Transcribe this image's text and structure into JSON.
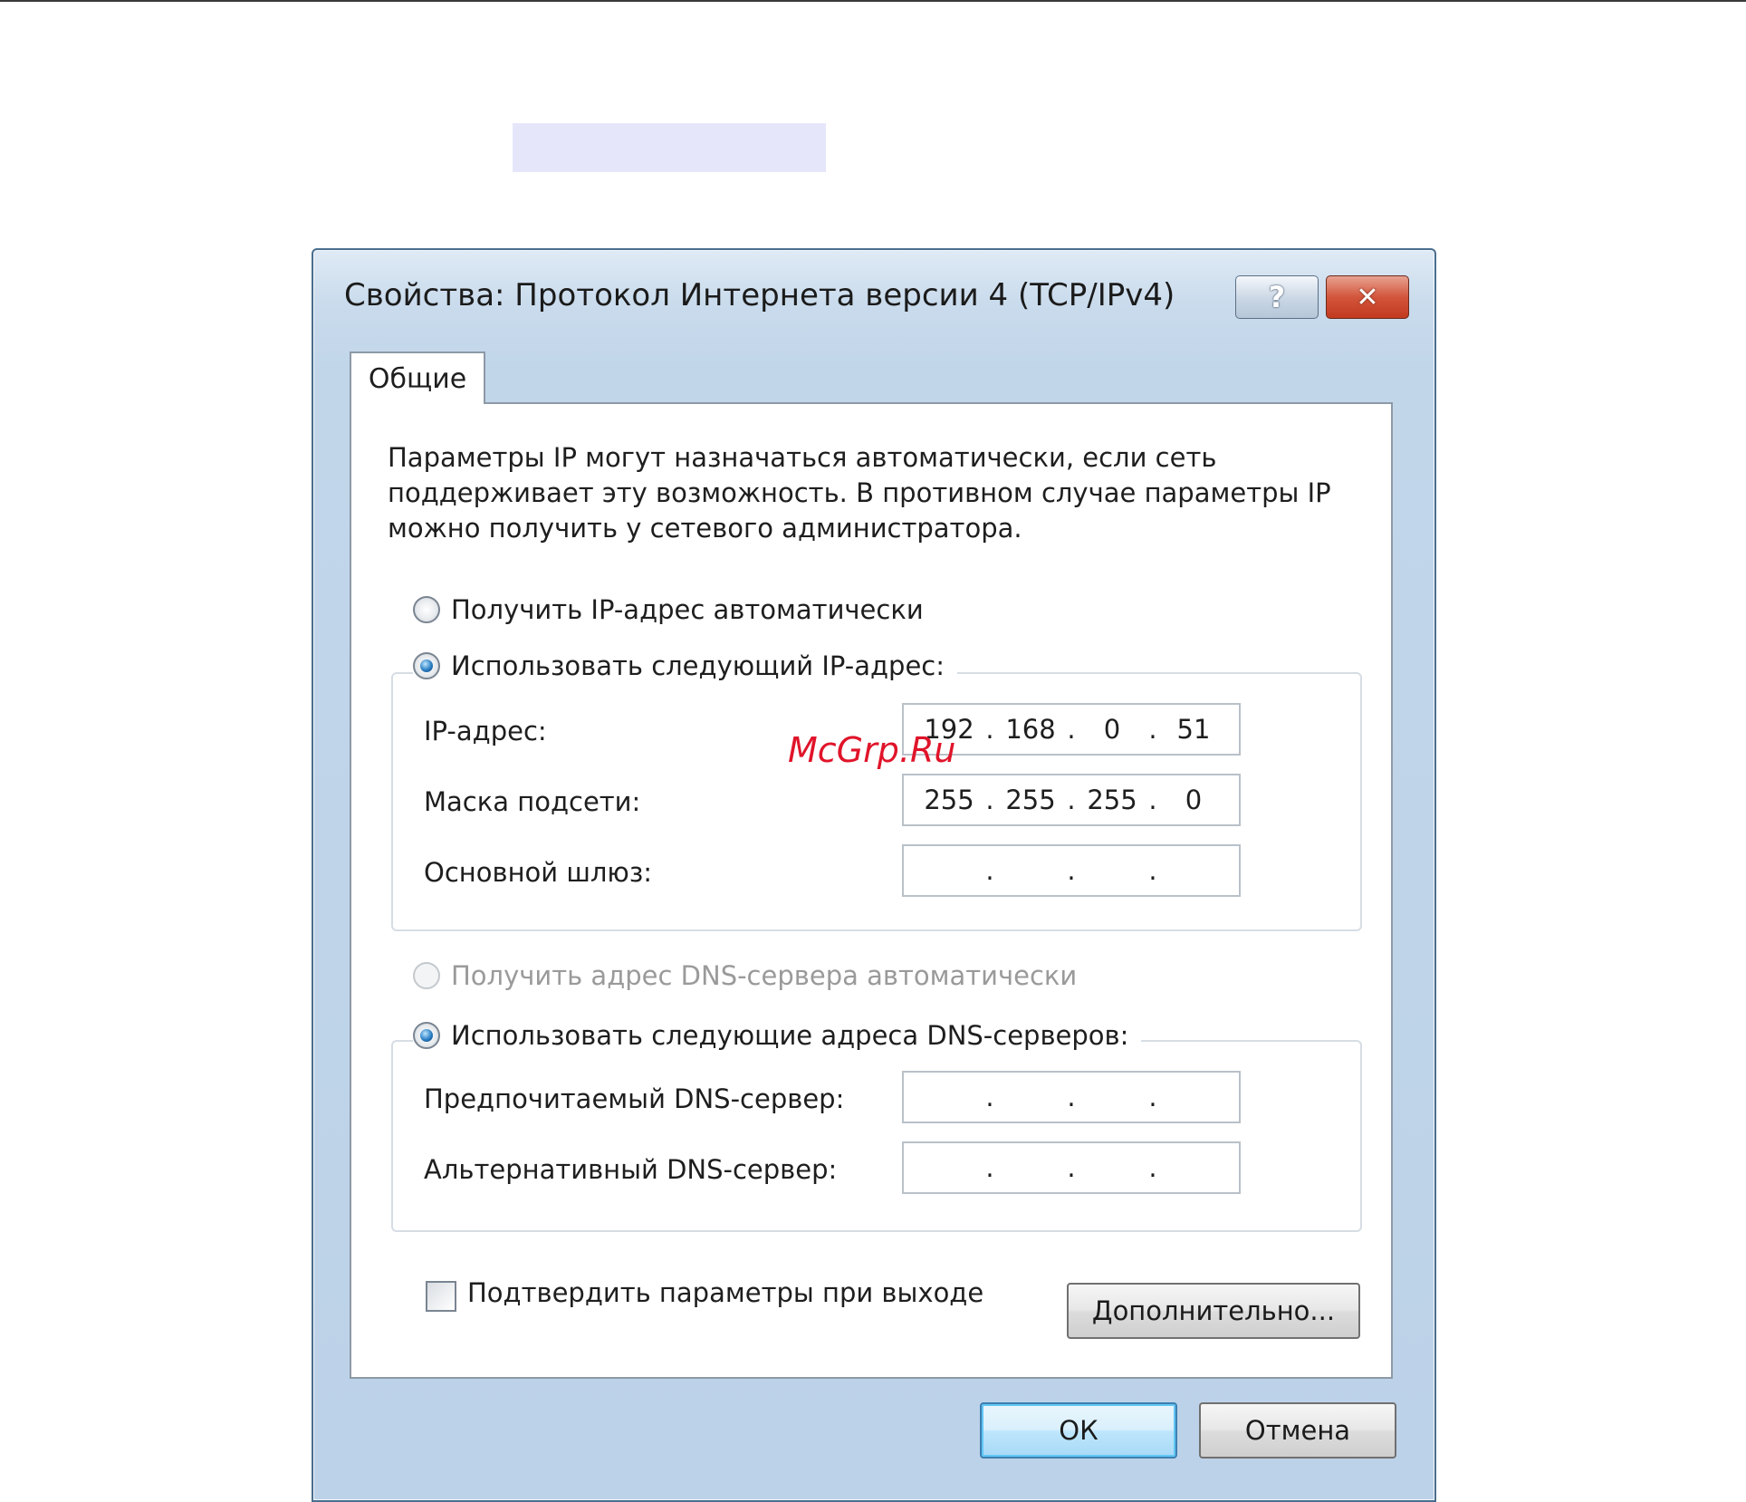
{
  "window": {
    "title": "Свойства: Протокол Интернета версии 4 (TCP/IPv4)",
    "help_glyph": "?",
    "close_glyph": "✕"
  },
  "tabs": [
    {
      "label": "Общие",
      "active": true
    }
  ],
  "intro_text": "Параметры IP могут назначаться автоматически, если сеть поддерживает эту возможность. В противном случае параметры IP можно получить у сетевого администратора.",
  "ip_mode": {
    "auto": {
      "label": "Получить IP-адрес автоматически",
      "selected": false
    },
    "manual": {
      "label": "Использовать следующий IP-адрес:",
      "selected": true
    }
  },
  "ip_fields": {
    "ip_address": {
      "label": "IP-адрес:",
      "octets": [
        "192",
        "168",
        "0",
        "51"
      ]
    },
    "subnet_mask": {
      "label": "Маска подсети:",
      "octets": [
        "255",
        "255",
        "255",
        "0"
      ]
    },
    "gateway": {
      "label": "Основной шлюз:",
      "octets": [
        "",
        "",
        "",
        ""
      ]
    }
  },
  "dns_mode": {
    "auto": {
      "label": "Получить адрес DNS-сервера автоматически",
      "selected": false,
      "disabled": true
    },
    "manual": {
      "label": "Использовать следующие адреса DNS-серверов:",
      "selected": true
    }
  },
  "dns_fields": {
    "preferred": {
      "label": "Предпочитаемый DNS-сервер:",
      "octets": [
        "",
        "",
        "",
        ""
      ]
    },
    "alternate": {
      "label": "Альтернативный DNS-сервер:",
      "octets": [
        "",
        "",
        "",
        ""
      ]
    }
  },
  "validate": {
    "label": "Подтвердить параметры при выходе",
    "checked": false
  },
  "buttons": {
    "advanced": "Дополнительно...",
    "ok": "ОК",
    "cancel": "Отмена"
  },
  "watermark": "McGrp.Ru",
  "ip_separator": "."
}
